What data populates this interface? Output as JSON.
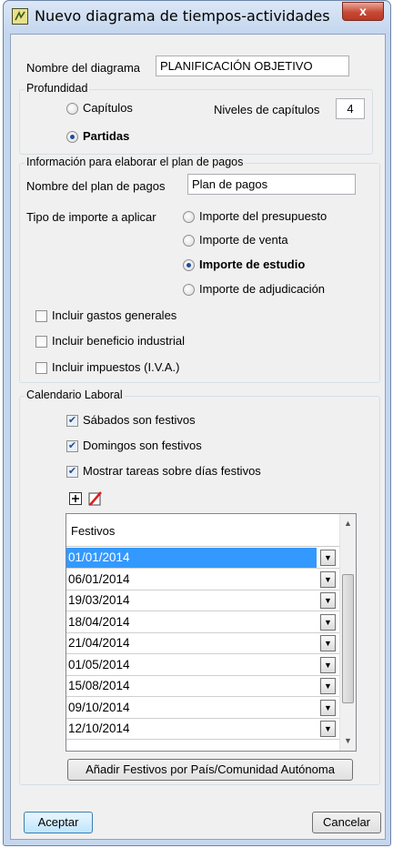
{
  "window": {
    "title": "Nuevo diagrama de tiempos-actividades",
    "close_label": "x"
  },
  "diagram": {
    "name_label": "Nombre del diagrama",
    "name_value": "PLANIFICACIÓN OBJETIVO"
  },
  "depth": {
    "group_label": "Profundidad",
    "chapters_label": "Capítulos",
    "levels_label": "Niveles de capítulos",
    "levels_value": "4",
    "partidas_label": "Partidas",
    "selected": "Partidas"
  },
  "payment": {
    "group_label": "Información para elaborar el plan de pagos",
    "plan_name_label": "Nombre del plan de pagos",
    "plan_name_value": "Plan de pagos",
    "amount_type_label": "Tipo de importe a aplicar",
    "options": [
      "Importe del presupuesto",
      "Importe de venta",
      "Importe de estudio",
      "Importe de adjudicación"
    ],
    "selected": "Importe de estudio",
    "checkboxes": [
      {
        "label": "Incluir gastos generales",
        "checked": false
      },
      {
        "label": "Incluir beneficio industrial",
        "checked": false
      },
      {
        "label": "Incluir impuestos (I.V.A.)",
        "checked": false
      }
    ]
  },
  "calendar": {
    "group_label": "Calendario Laboral",
    "checkboxes": [
      {
        "label": "Sábados son festivos",
        "checked": true
      },
      {
        "label": "Domingos son festivos",
        "checked": true
      },
      {
        "label": "Mostrar tareas sobre días festivos",
        "checked": true
      }
    ],
    "toolbar_icons": [
      "add-row-icon",
      "delete-row-icon"
    ],
    "grid_header": "Festivos",
    "holidays": [
      "01/01/2014",
      "06/01/2014",
      "19/03/2014",
      "18/04/2014",
      "21/04/2014",
      "01/05/2014",
      "15/08/2014",
      "09/10/2014",
      "12/10/2014"
    ],
    "selected_index": 0,
    "add_holidays_button": "Añadir Festivos por País/Comunidad Autónoma"
  },
  "footer": {
    "accept_label": "Aceptar",
    "cancel_label": "Cancelar"
  },
  "colors": {
    "selection": "#3399ff",
    "frame": "#c5d7ee",
    "close_button": "#c74a36"
  }
}
